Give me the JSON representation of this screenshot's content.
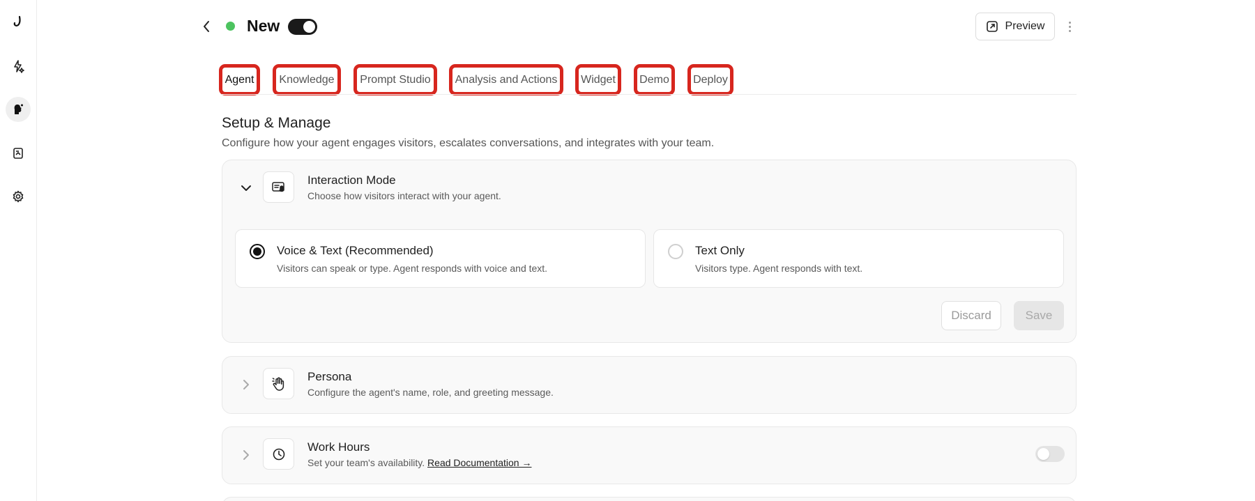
{
  "sidebar": {
    "items": [
      {
        "icon": "logo-icon"
      },
      {
        "icon": "lightning-sparkle-icon"
      },
      {
        "icon": "agent-icon",
        "active": true
      },
      {
        "icon": "document-icon"
      },
      {
        "icon": "gear-icon"
      }
    ]
  },
  "header": {
    "agent_name": "New",
    "status_color": "#4cc35f",
    "enabled": true,
    "preview_label": "Preview"
  },
  "tabs": [
    {
      "label": "Agent",
      "active": true
    },
    {
      "label": "Knowledge"
    },
    {
      "label": "Prompt Studio"
    },
    {
      "label": "Analysis and Actions"
    },
    {
      "label": "Widget"
    },
    {
      "label": "Demo"
    },
    {
      "label": "Deploy"
    }
  ],
  "section": {
    "title": "Setup & Manage",
    "description": "Configure how your agent engages visitors, escalates conversations, and integrates with your team."
  },
  "interaction_mode": {
    "title": "Interaction Mode",
    "subtitle": "Choose how visitors interact with your agent.",
    "options": [
      {
        "title": "Voice & Text (Recommended)",
        "description": "Visitors can speak or type. Agent responds with voice and text.",
        "selected": true
      },
      {
        "title": "Text Only",
        "description": "Visitors type. Agent responds with text.",
        "selected": false
      }
    ],
    "discard_label": "Discard",
    "save_label": "Save"
  },
  "persona": {
    "title": "Persona",
    "subtitle": "Configure the agent's name, role, and greeting message."
  },
  "work_hours": {
    "title": "Work Hours",
    "subtitle": "Set your team's availability.",
    "link_label": "Read Documentation →",
    "enabled": false
  }
}
